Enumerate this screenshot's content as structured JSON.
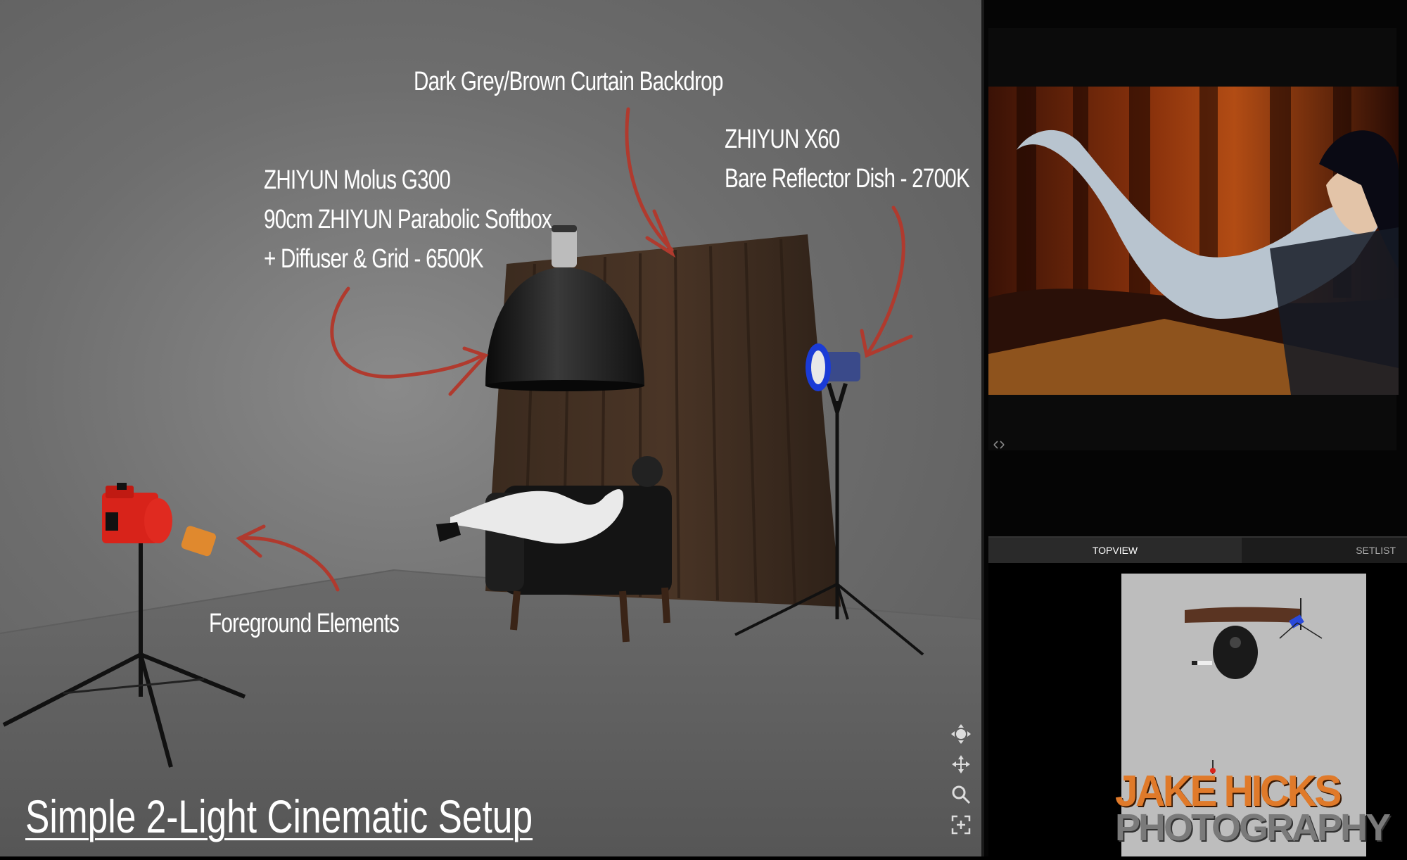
{
  "scene": {
    "backdrop_label": "Dark Grey/Brown Curtain Backdrop",
    "key_light_label": [
      "ZHIYUN Molus G300",
      "90cm ZHIYUN Parabolic Softbox",
      "+ Diffuser & Grid - 6500K"
    ],
    "rim_light_label": [
      "ZHIYUN X60",
      "Bare Reflector Dish - 2700K"
    ],
    "foreground_label": "Foreground Elements",
    "title": "Simple 2-Light Cinematic Setup"
  },
  "viewport_tools": [
    "orbit-icon",
    "pan-icon",
    "zoom-icon",
    "frame-icon"
  ],
  "side_panel": {
    "tabs": [
      {
        "label": "TOPVIEW",
        "active": true
      },
      {
        "label": "SETLIST",
        "active": false
      }
    ],
    "watermark": [
      "JAKE HICKS",
      "PHOTOGRAPHY"
    ]
  },
  "colors": {
    "annotation_arrow": "#b03a2e",
    "camera": "#d8231a",
    "watermark_orange": "#e07a2a"
  }
}
